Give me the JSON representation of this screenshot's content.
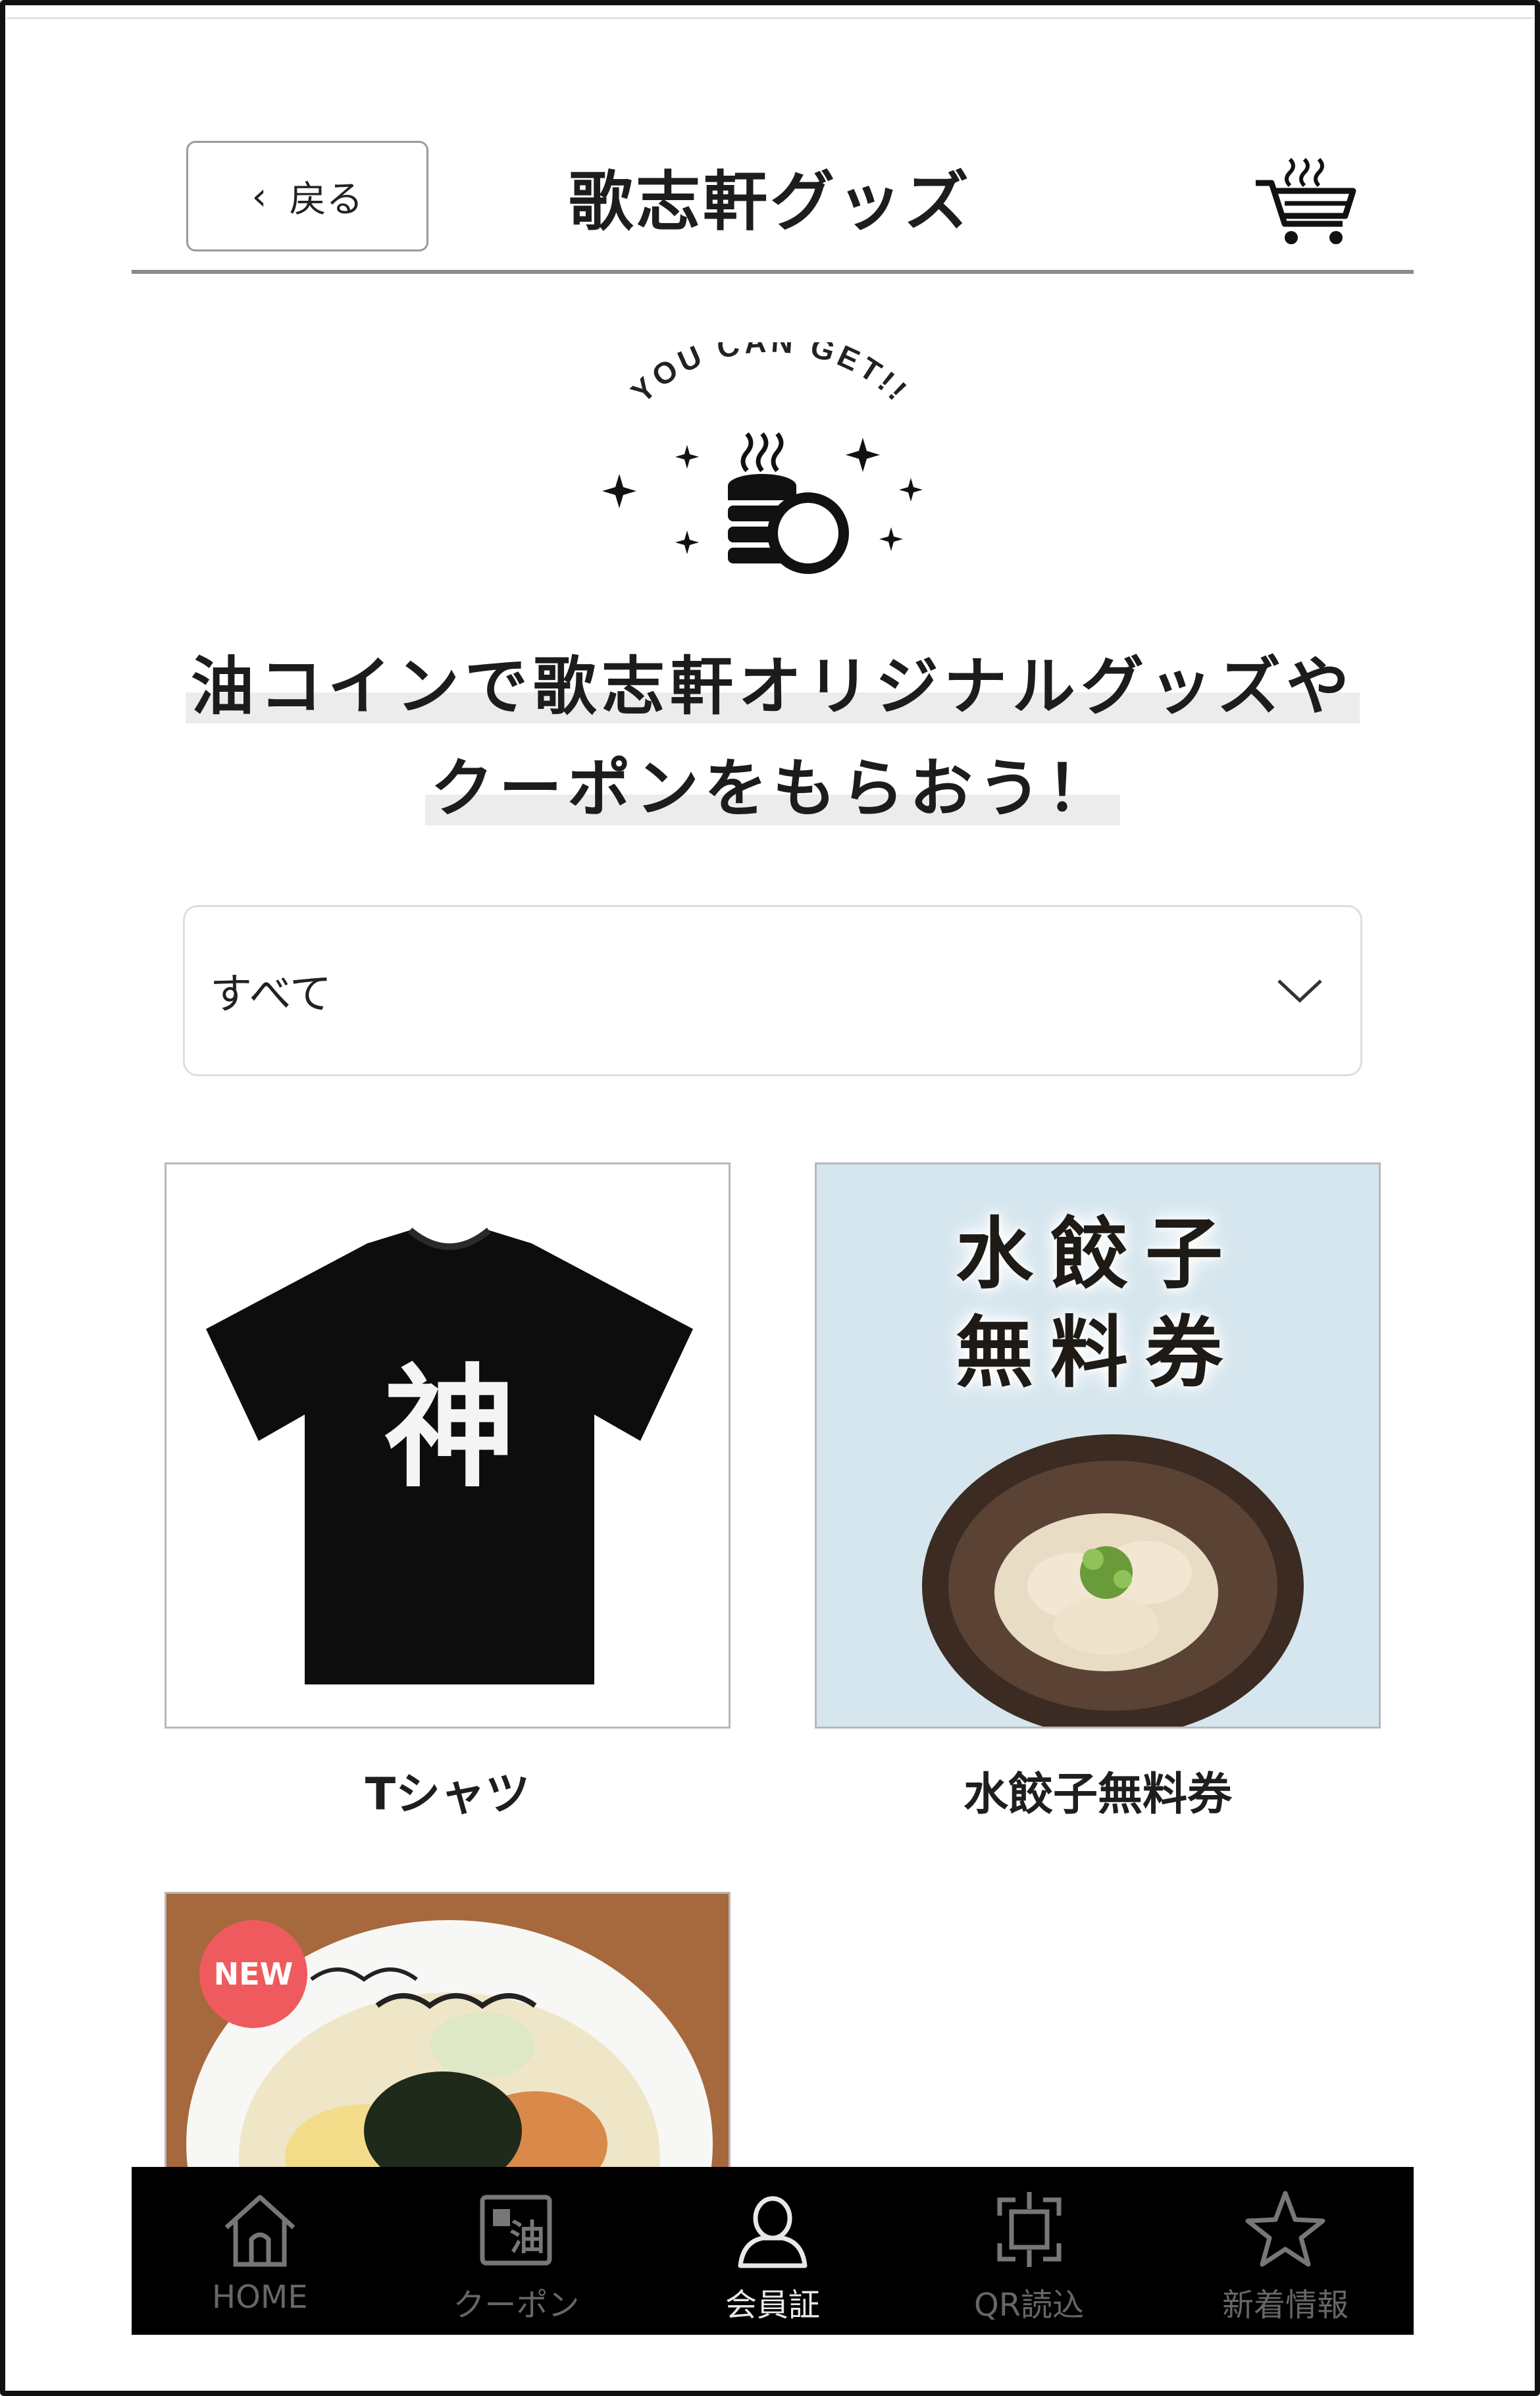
{
  "header": {
    "back_label": "戻る",
    "title": "歌志軒グッズ",
    "cart_icon": "cart-icon"
  },
  "hero": {
    "badge_text": "YOU CAN GET!!",
    "headline_line1": "油コインで歌志軒オリジナルグッズや",
    "headline_line2": "クーポンをもらおう！"
  },
  "filter": {
    "selected": "すべて"
  },
  "products": [
    {
      "name": "Tシャツ",
      "image_text": "神"
    },
    {
      "name": "水餃子無料券",
      "image_line1": "水餃子",
      "image_line2": "無料券"
    },
    {
      "name": "",
      "badge": "NEW"
    }
  ],
  "tabbar": {
    "items": [
      {
        "label": "HOME",
        "icon": "home-icon"
      },
      {
        "label": "クーポン",
        "icon": "coupon-icon"
      },
      {
        "label": "会員証",
        "icon": "member-card-icon",
        "active": true
      },
      {
        "label": "QR読込",
        "icon": "qr-scan-icon"
      },
      {
        "label": "新着情報",
        "icon": "star-icon"
      }
    ]
  },
  "colors": {
    "tabbar_bg": "#000000",
    "new_badge": "#ee5a5e",
    "coupon_bg": "#d6e6ee"
  }
}
